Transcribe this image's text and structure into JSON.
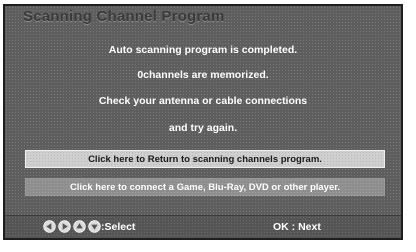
{
  "dialog": {
    "title": "Scanning Channel Program",
    "messages": [
      "Auto scanning program is completed.",
      "0channels are memorized.",
      "Check your antenna or cable connections",
      "and try again."
    ],
    "options": [
      "Click here to Return to scanning channels program.",
      "Click here to connect a Game, Blu-Ray, DVD or other player."
    ]
  },
  "footer": {
    "nav_icons": [
      "left-arrow-icon",
      "right-arrow-icon",
      "up-arrow-icon",
      "down-arrow-icon"
    ],
    "select_label": ":Select",
    "ok_label": "OK : Next"
  }
}
